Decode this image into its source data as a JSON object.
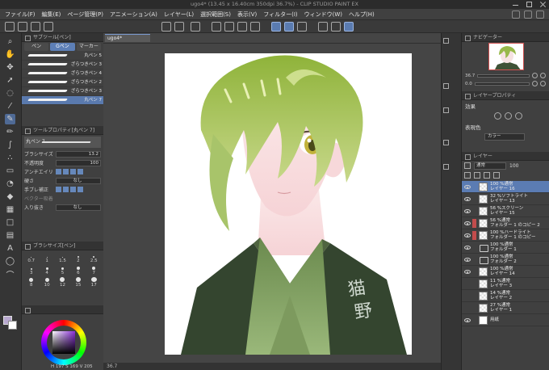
{
  "window": {
    "title": "ugo4* (13.45 x 16.40cm 350dpi 36.7%) - CLIP STUDIO PAINT EX"
  },
  "menu": {
    "items": [
      "ファイル(F)",
      "編集(E)",
      "ページ管理(P)",
      "アニメーション(A)",
      "レイヤー(L)",
      "選択範囲(S)",
      "表示(V)",
      "フィルター(I)",
      "ウィンドウ(W)",
      "ヘルプ(H)"
    ]
  },
  "sub_tool_panel": {
    "header": "サブツール[ペン]",
    "tabs": [
      "ペン",
      "Gペン",
      "マーカー"
    ],
    "brushes": [
      "丸ペン 5",
      "ざらつきペン 3",
      "ざらつきペン 4",
      "ざらつきペン 2",
      "ざらつきペン 3",
      "丸ペン 7"
    ],
    "selected_index": 5
  },
  "tool_property": {
    "header": "ツールプロパティ[丸ペン 7]",
    "preview_label": "丸ペン 7",
    "rows": [
      {
        "label": "ブラシサイズ",
        "value": "13.2"
      },
      {
        "label": "不透明度",
        "value": "100"
      },
      {
        "label": "アンチエイリアス",
        "value": ""
      },
      {
        "label": "硬さ",
        "value": "なし"
      },
      {
        "label": "手ブレ補正",
        "value": ""
      },
      {
        "label": "ベクター吸着",
        "value": ""
      },
      {
        "label": "入り抜き",
        "value": "なし"
      }
    ]
  },
  "brush_size_panel": {
    "header": "ブラシサイズ[ペン]",
    "sizes": [
      "0.7",
      "1",
      "1.5",
      "2",
      "2.5",
      "3",
      "4",
      "5",
      "6",
      "7",
      "8",
      "10",
      "12",
      "15",
      "17"
    ]
  },
  "color": {
    "main": "#b8a8cf",
    "sub": "#ffffff",
    "hsv": "H 197 S 169 V 205"
  },
  "canvas": {
    "tab_label": "ugo4*",
    "status": "36.7"
  },
  "navigator": {
    "header": "ナビゲーター",
    "zoom": "36.7",
    "rotation": "0.0"
  },
  "layer_property": {
    "header": "レイヤープロパティ",
    "effect_label": "効果",
    "expression_label": "表現色",
    "expression_value": "カラー"
  },
  "layer_panel": {
    "header": "レイヤー",
    "blend_mode": "通常",
    "opacity": "100",
    "layers": [
      {
        "percent": "100 %通常",
        "name": "レイヤー 16",
        "visible": true,
        "selected": true,
        "thumb": "pixel",
        "marker": ""
      },
      {
        "percent": "32 %ソフトライト",
        "name": "レイヤー 13",
        "visible": true,
        "selected": false,
        "thumb": "pixel",
        "marker": ""
      },
      {
        "percent": "56 %スクリーン",
        "name": "レイヤー 15",
        "visible": true,
        "selected": false,
        "thumb": "pixel",
        "marker": ""
      },
      {
        "percent": "56 %通常",
        "name": "フォルダー 1 のコピー 2",
        "visible": true,
        "selected": false,
        "thumb": "pixel",
        "marker": "red"
      },
      {
        "percent": "100 %ハードライト",
        "name": "フォルダー 1 のコピー",
        "visible": true,
        "selected": false,
        "thumb": "pixel",
        "marker": "red"
      },
      {
        "percent": "100 %通常",
        "name": "フォルダー 1",
        "visible": true,
        "selected": false,
        "thumb": "folder",
        "marker": ""
      },
      {
        "percent": "100 %通常",
        "name": "フォルダー 2",
        "visible": true,
        "selected": false,
        "thumb": "folder",
        "marker": ""
      },
      {
        "percent": "100 %通常",
        "name": "レイヤー 14",
        "visible": true,
        "selected": false,
        "thumb": "pixel",
        "marker": ""
      },
      {
        "percent": "11 %通常",
        "name": "レイヤー 3",
        "visible": false,
        "selected": false,
        "thumb": "pixel",
        "marker": ""
      },
      {
        "percent": "14 %通常",
        "name": "レイヤー 2",
        "visible": false,
        "selected": false,
        "thumb": "pixel",
        "marker": ""
      },
      {
        "percent": "27 %通常",
        "name": "レイヤー 1",
        "visible": false,
        "selected": false,
        "thumb": "pixel",
        "marker": ""
      },
      {
        "percent": "",
        "name": "用紙",
        "visible": true,
        "selected": false,
        "thumb": "paper",
        "marker": ""
      }
    ]
  },
  "artwork": {
    "signature": "猫野"
  }
}
